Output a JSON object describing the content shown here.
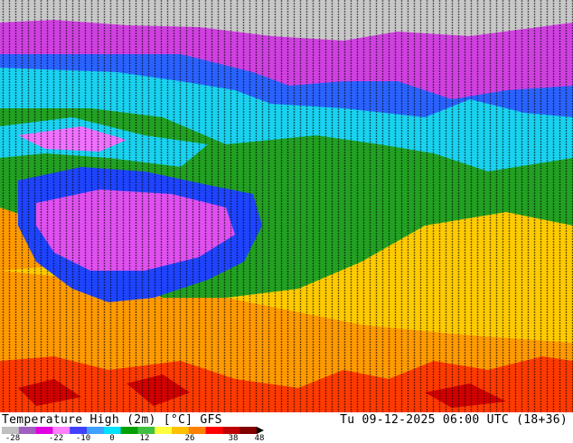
{
  "map": {
    "title": "Temperature High (2m) [°C] GFS",
    "valid_time": "Tu 09-12-2025 06:00 UTC (18+36)",
    "colorbar": {
      "tick_labels": [
        "-28",
        "-22",
        "-10",
        "0",
        "12",
        "26",
        "38",
        "48"
      ],
      "colors": [
        "#c0c0c0",
        "#a060c0",
        "#e000e0",
        "#ff80ff",
        "#4040ff",
        "#40a0ff",
        "#00e0ff",
        "#00a000",
        "#40c040",
        "#ffff40",
        "#ffc000",
        "#ff8000",
        "#ff0000",
        "#c00000",
        "#800000"
      ]
    }
  }
}
